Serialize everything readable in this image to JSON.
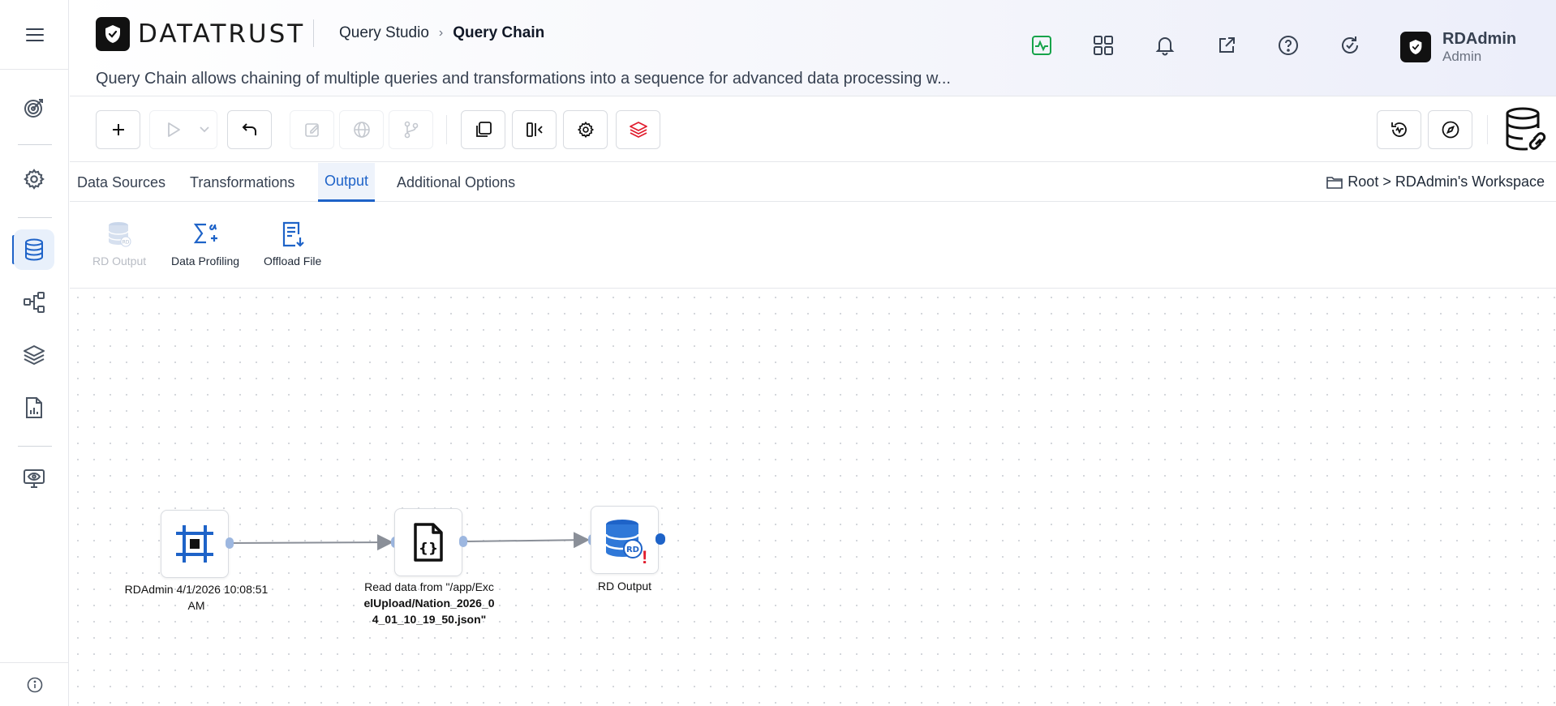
{
  "app": {
    "brand": "DATATRUST",
    "breadcrumb_parent": "Query Studio",
    "breadcrumb_current": "Query Chain",
    "description": "Query Chain allows chaining of multiple queries and transformations into a sequence for advanced data processing w..."
  },
  "header_icons": [
    "activity-icon",
    "apps-grid-icon",
    "bell-icon",
    "external-link-icon",
    "help-circle-icon",
    "refresh-check-icon"
  ],
  "user": {
    "name": "RDAdmin",
    "role": "Admin"
  },
  "sidebar": {
    "items": [
      "target-icon",
      "settings-gear-icon",
      "database-icon",
      "hierarchy-icon",
      "layers-icon",
      "report-chart-icon",
      "monitor-eye-icon"
    ],
    "active": "database-icon",
    "footer": "info-icon"
  },
  "toolbar": {
    "buttons": [
      "add",
      "run",
      "run-options",
      "undo",
      "edit",
      "globe",
      "branch",
      "copy",
      "split-view",
      "settings",
      "stack"
    ],
    "right_buttons": [
      "history-check",
      "compass"
    ]
  },
  "tabs": [
    {
      "label": "Data Sources",
      "active": false
    },
    {
      "label": "Transformations",
      "active": false
    },
    {
      "label": "Output",
      "active": true
    },
    {
      "label": "Additional Options",
      "active": false
    }
  ],
  "workspace_path": "Root > RDAdmin's Workspace",
  "output_tools": [
    {
      "label": "RD Output",
      "enabled": false
    },
    {
      "label": "Data Profiling",
      "enabled": true
    },
    {
      "label": "Offload File",
      "enabled": true
    }
  ],
  "flow": {
    "nodes": [
      {
        "id": "source",
        "label": "RDAdmin 4/1/2026 10:08:51 AM"
      },
      {
        "id": "reader",
        "label_prefix": "Read data from ",
        "label_path": "\"/app/ExcelUpload/Nation_2026_04_01_10_19_50.json\"",
        "label_display_1": "Read data from \"/app/Exc",
        "label_display_2": "elUpload/Nation_2026_0",
        "label_display_3": "4_01_10_19_50.json\""
      },
      {
        "id": "output",
        "label": "RD Output",
        "warning": "!"
      }
    ],
    "edges": [
      [
        "source",
        "reader"
      ],
      [
        "reader",
        "output"
      ]
    ]
  },
  "colors": {
    "accent": "#1e63c8",
    "warning": "#e11d2e",
    "activity": "#16a34a"
  }
}
